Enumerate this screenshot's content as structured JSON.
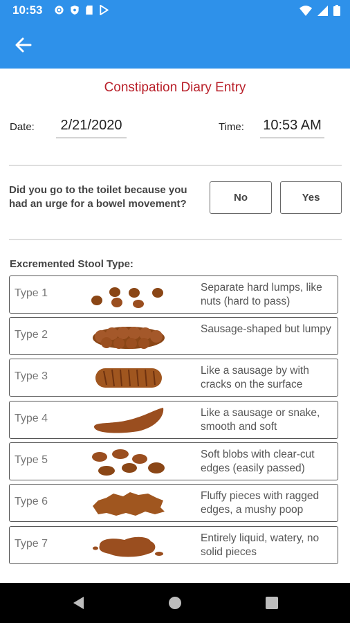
{
  "status_bar": {
    "time": "10:53",
    "icons_left": [
      "gear-icon",
      "shield-icon",
      "sd-card-icon",
      "play-store-icon"
    ],
    "icons_right": [
      "wifi-icon",
      "signal-icon",
      "battery-icon"
    ]
  },
  "app_bar": {
    "back_icon": "arrow-left-icon",
    "color": "#2e91ea"
  },
  "title": "Constipation Diary Entry",
  "date": {
    "label": "Date:",
    "value": "2/21/2020"
  },
  "time": {
    "label": "Time:",
    "value": "10:53 AM"
  },
  "question": {
    "text": "Did you go to the toilet because you had an urge for a bowel movement?",
    "options": [
      "No",
      "Yes"
    ]
  },
  "stool_section_label": "Excremented Stool Type:",
  "stool_types": [
    {
      "label": "Type 1",
      "description": "Separate hard lumps, like nuts (hard to pass)"
    },
    {
      "label": "Type 2",
      "description": "Sausage-shaped but lumpy"
    },
    {
      "label": "Type 3",
      "description": "Like a sausage by with cracks on the surface"
    },
    {
      "label": "Type 4",
      "description": "Like a sausage or snake, smooth and soft"
    },
    {
      "label": "Type 5",
      "description": "Soft blobs with clear-cut edges (easily passed)"
    },
    {
      "label": "Type 6",
      "description": "Fluffy pieces with ragged edges, a mushy poop"
    },
    {
      "label": "Type 7",
      "description": "Entirely liquid, watery, no solid pieces"
    }
  ],
  "nav_bar": {
    "icons": [
      "back-triangle-icon",
      "home-circle-icon",
      "recents-square-icon"
    ]
  },
  "colors": {
    "title": "#b9202a",
    "stool_brown": "#9a4e1f"
  }
}
